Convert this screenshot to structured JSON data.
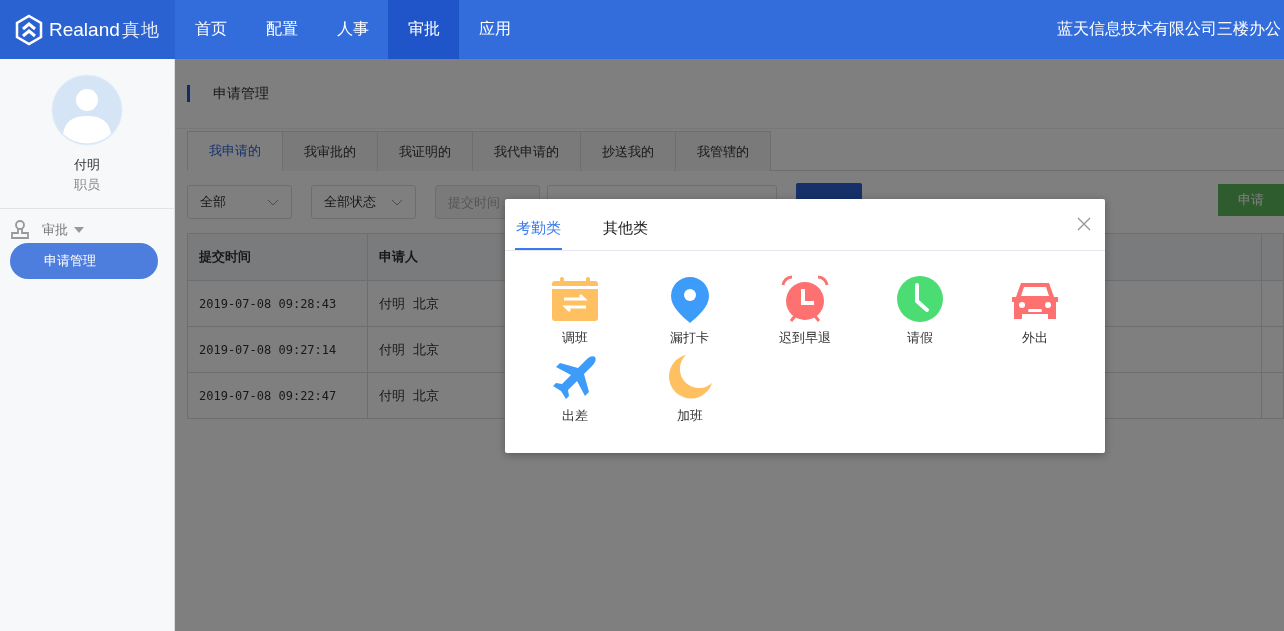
{
  "logo": {
    "text": "Realand",
    "text_cn": "真地"
  },
  "nav": [
    {
      "label": "首页",
      "selected": false
    },
    {
      "label": "配置",
      "selected": false
    },
    {
      "label": "人事",
      "selected": false
    },
    {
      "label": "审批",
      "selected": true
    },
    {
      "label": "应用",
      "selected": false
    }
  ],
  "company": "蓝天信息技术有限公司三楼办公",
  "sidebar": {
    "user": {
      "name": "付明",
      "role": "职员"
    },
    "groups": [
      {
        "label": "审批",
        "expanded": true,
        "items": [
          {
            "label": "申请管理",
            "selected": true
          }
        ]
      }
    ]
  },
  "page_title": "申请管理",
  "tabs": [
    {
      "label": "我申请的",
      "selected": true
    },
    {
      "label": "我审批的",
      "selected": false
    },
    {
      "label": "我证明的",
      "selected": false
    },
    {
      "label": "我代申请的",
      "selected": false
    },
    {
      "label": "抄送我的",
      "selected": false
    },
    {
      "label": "我管辖的",
      "selected": false
    }
  ],
  "filters": {
    "type_select": "全部",
    "status_select": "全部状态",
    "time_placeholder": "提交时间",
    "apply_button": "申请"
  },
  "table": {
    "columns": [
      "提交时间",
      "申请人"
    ],
    "rows": [
      {
        "time": "2019-07-08 09:28:43",
        "applicant": "付明",
        "city": "北京"
      },
      {
        "time": "2019-07-08 09:27:14",
        "applicant": "付明",
        "city": "北京"
      },
      {
        "time": "2019-07-08 09:22:47",
        "applicant": "付明",
        "city": "北京"
      }
    ]
  },
  "dialog": {
    "tabs": [
      {
        "label": "考勤类",
        "selected": true
      },
      {
        "label": "其他类",
        "selected": false
      }
    ],
    "items": [
      {
        "kind": "calendar",
        "label": "调班",
        "color": "#ffc062"
      },
      {
        "kind": "pin",
        "label": "漏打卡",
        "color": "#3d9bfa"
      },
      {
        "kind": "alarm",
        "label": "迟到早退",
        "color": "#fd7171"
      },
      {
        "kind": "clock",
        "label": "请假",
        "color": "#4cdc74"
      },
      {
        "kind": "car",
        "label": "外出",
        "color": "#fd7171"
      },
      {
        "kind": "plane",
        "label": "出差",
        "color": "#3d9bfa"
      },
      {
        "kind": "moon",
        "label": "加班",
        "color": "#ffc062"
      }
    ]
  }
}
